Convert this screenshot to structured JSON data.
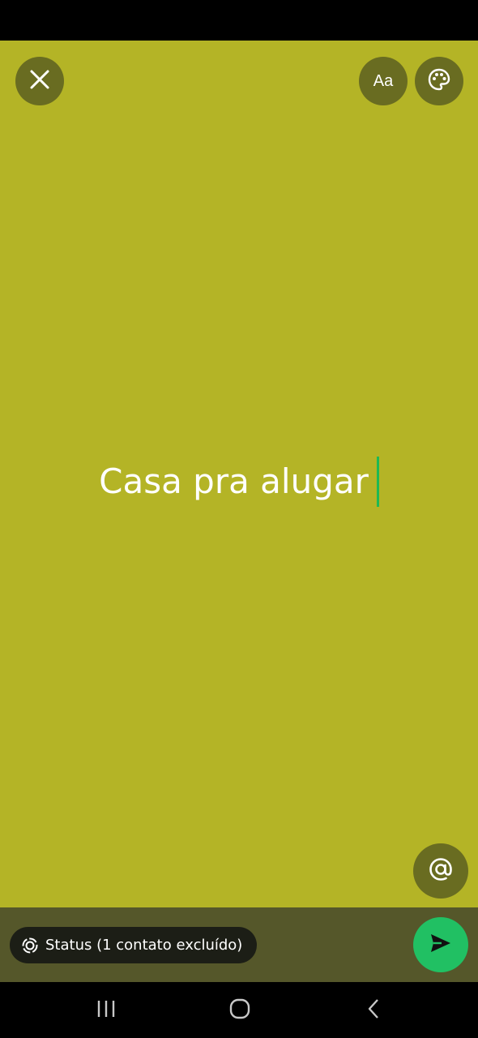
{
  "composer": {
    "text": "Casa pra alugar",
    "background_color": "#b4b426",
    "caret_color": "#1db954"
  },
  "toolbar": {
    "close_icon": "close-icon",
    "font_label": "Aa",
    "palette_icon": "palette-icon"
  },
  "mention": {
    "icon": "at-sign-icon"
  },
  "audience": {
    "icon": "status-ring-icon",
    "label": "Status (1 contato excluído)"
  },
  "send": {
    "icon": "send-icon",
    "color": "#21c063"
  },
  "navigation": {
    "recent_icon": "recent-apps-icon",
    "home_icon": "home-icon",
    "back_icon": "back-icon"
  }
}
